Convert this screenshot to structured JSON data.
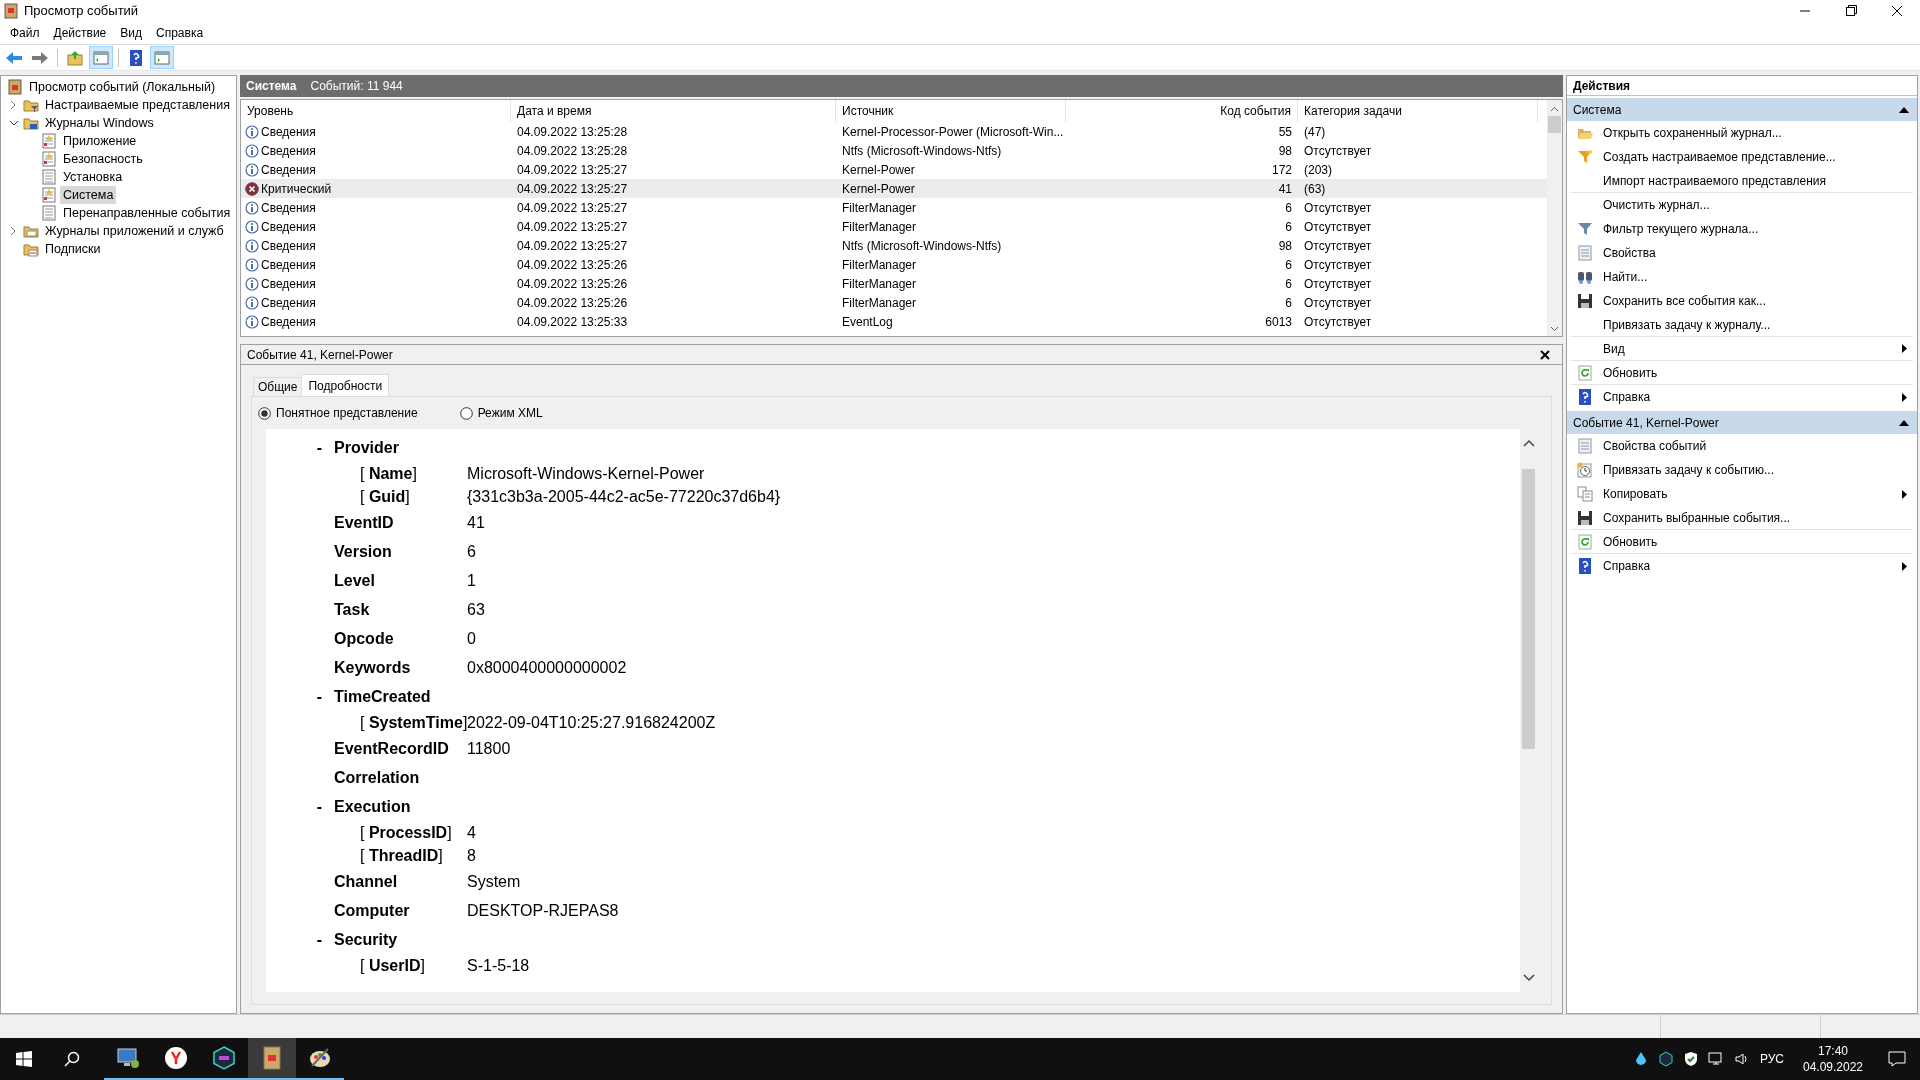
{
  "window": {
    "title": "Просмотр событий"
  },
  "menu": [
    "Файл",
    "Действие",
    "Вид",
    "Справка"
  ],
  "toolbar": [
    {
      "kind": "back",
      "pressed": false
    },
    {
      "kind": "forward",
      "pressed": false
    },
    {
      "kind": "up",
      "pressed": false
    },
    {
      "kind": "panel-left",
      "pressed": true
    },
    {
      "kind": "help",
      "pressed": false
    },
    {
      "kind": "panel-right",
      "pressed": true
    }
  ],
  "tree": [
    {
      "label": "Просмотр событий (Локальный)",
      "kind": "root",
      "selected": false,
      "children": [
        {
          "label": "Настраиваемые представления",
          "kind": "folder-filter",
          "selected": false,
          "expanded": false
        },
        {
          "label": "Журналы Windows",
          "kind": "folder-windows",
          "selected": false,
          "expanded": true,
          "children": [
            {
              "label": "Приложение",
              "kind": "log-warn",
              "selected": false
            },
            {
              "label": "Безопасность",
              "kind": "log-warn",
              "selected": false
            },
            {
              "label": "Установка",
              "kind": "log",
              "selected": false
            },
            {
              "label": "Система",
              "kind": "log-warn",
              "selected": true
            },
            {
              "label": "Перенаправленные события",
              "kind": "log",
              "selected": false
            }
          ]
        },
        {
          "label": "Журналы приложений и служб",
          "kind": "folder",
          "selected": false,
          "expanded": false
        },
        {
          "label": "Подписки",
          "kind": "subscriptions",
          "selected": false
        }
      ]
    }
  ],
  "log_header": {
    "name": "Система",
    "count": "Событий: 11 944"
  },
  "table": {
    "columns": [
      "Уровень",
      "Дата и время",
      "Источник",
      "Код события",
      "Категория задачи"
    ],
    "rows": [
      {
        "kind": "info",
        "level": "Сведения",
        "date": "04.09.2022 13:25:28",
        "source": "Kernel-Processor-Power (Microsoft-Win...",
        "code": "55",
        "category": "(47)",
        "selected": false
      },
      {
        "kind": "info",
        "level": "Сведения",
        "date": "04.09.2022 13:25:28",
        "source": "Ntfs (Microsoft-Windows-Ntfs)",
        "code": "98",
        "category": "Отсутствует",
        "selected": false
      },
      {
        "kind": "info",
        "level": "Сведения",
        "date": "04.09.2022 13:25:27",
        "source": "Kernel-Power",
        "code": "172",
        "category": "(203)",
        "selected": false
      },
      {
        "kind": "critical",
        "level": "Критический",
        "date": "04.09.2022 13:25:27",
        "source": "Kernel-Power",
        "code": "41",
        "category": "(63)",
        "selected": true
      },
      {
        "kind": "info",
        "level": "Сведения",
        "date": "04.09.2022 13:25:27",
        "source": "FilterManager",
        "code": "6",
        "category": "Отсутствует",
        "selected": false
      },
      {
        "kind": "info",
        "level": "Сведения",
        "date": "04.09.2022 13:25:27",
        "source": "FilterManager",
        "code": "6",
        "category": "Отсутствует",
        "selected": false
      },
      {
        "kind": "info",
        "level": "Сведения",
        "date": "04.09.2022 13:25:27",
        "source": "Ntfs (Microsoft-Windows-Ntfs)",
        "code": "98",
        "category": "Отсутствует",
        "selected": false
      },
      {
        "kind": "info",
        "level": "Сведения",
        "date": "04.09.2022 13:25:26",
        "source": "FilterManager",
        "code": "6",
        "category": "Отсутствует",
        "selected": false
      },
      {
        "kind": "info",
        "level": "Сведения",
        "date": "04.09.2022 13:25:26",
        "source": "FilterManager",
        "code": "6",
        "category": "Отсутствует",
        "selected": false
      },
      {
        "kind": "info",
        "level": "Сведения",
        "date": "04.09.2022 13:25:26",
        "source": "FilterManager",
        "code": "6",
        "category": "Отсутствует",
        "selected": false
      },
      {
        "kind": "info",
        "level": "Сведения",
        "date": "04.09.2022 13:25:33",
        "source": "EventLog",
        "code": "6013",
        "category": "Отсутствует",
        "selected": false
      }
    ]
  },
  "event_panel": {
    "title": "Событие 41, Kernel-Power",
    "tabs": [
      {
        "label": "Общие",
        "selected": false
      },
      {
        "label": "Подробности",
        "selected": true
      }
    ],
    "views": [
      {
        "label": "Понятное представление",
        "selected": true
      },
      {
        "label": "Режим XML",
        "selected": false
      }
    ],
    "details": [
      {
        "kind": "section",
        "toggle": "-",
        "label": "Provider",
        "children": [
          {
            "name": "[ **Name**]",
            "value": "Microsoft-Windows-Kernel-Power"
          },
          {
            "name": "[ **Guid**]",
            "value": "{331c3b3a-2005-44c2-ac5e-77220c37d6b4}"
          }
        ]
      },
      {
        "kind": "field",
        "label": "EventID",
        "value": "41"
      },
      {
        "kind": "field",
        "label": "Version",
        "value": "6"
      },
      {
        "kind": "field",
        "label": "Level",
        "value": "1"
      },
      {
        "kind": "field",
        "label": "Task",
        "value": "63"
      },
      {
        "kind": "field",
        "label": "Opcode",
        "value": "0"
      },
      {
        "kind": "field",
        "label": "Keywords",
        "value": "0x8000400000000002"
      },
      {
        "kind": "section",
        "toggle": "-",
        "label": "TimeCreated",
        "children": [
          {
            "name": "[ **SystemTime**]",
            "value": "2022-09-04T10:25:27.916824200Z"
          }
        ]
      },
      {
        "kind": "field",
        "label": "EventRecordID",
        "value": "11800"
      },
      {
        "kind": "field",
        "label": "Correlation"
      },
      {
        "kind": "section",
        "toggle": "-",
        "label": "Execution",
        "children": [
          {
            "name": "[ **ProcessID**]",
            "value": "4"
          },
          {
            "name": "[ **ThreadID**]",
            "value": "8"
          }
        ]
      },
      {
        "kind": "field",
        "label": "Channel",
        "value": "System"
      },
      {
        "kind": "field",
        "label": "Computer",
        "value": "DESKTOP-RJEPAS8"
      },
      {
        "kind": "section",
        "toggle": "-",
        "label": "Security",
        "children": [
          {
            "name": "[ **UserID**]",
            "value": "S-1-5-18"
          }
        ]
      }
    ]
  },
  "actions": {
    "title": "Действия",
    "sections": [
      {
        "title": "Система",
        "expanded": true,
        "items": [
          {
            "label": "Открыть сохраненный журнал...",
            "kind": "open",
            "submenu": false,
            "divider_after": false
          },
          {
            "label": "Создать настраиваемое представление...",
            "kind": "filter-star",
            "submenu": false,
            "divider_after": false
          },
          {
            "label": "Импорт настраиваемого представления",
            "kind": "none",
            "submenu": false,
            "divider_after": true
          },
          {
            "label": "Очистить журнал...",
            "kind": "none",
            "submenu": false,
            "divider_after": false
          },
          {
            "label": "Фильтр текущего журнала...",
            "kind": "filter",
            "submenu": false,
            "divider_after": false
          },
          {
            "label": "Свойства",
            "kind": "properties",
            "submenu": false,
            "divider_after": false
          },
          {
            "label": "Найти...",
            "kind": "find",
            "submenu": false,
            "divider_after": false
          },
          {
            "label": "Сохранить все события как...",
            "kind": "save",
            "submenu": false,
            "divider_after": false
          },
          {
            "label": "Привязать задачу к журналу...",
            "kind": "none",
            "submenu": false,
            "divider_after": true
          },
          {
            "label": "Вид",
            "kind": "none",
            "submenu": true,
            "divider_after": true
          },
          {
            "label": "Обновить",
            "kind": "refresh",
            "submenu": false,
            "divider_after": true
          },
          {
            "label": "Справка",
            "kind": "help",
            "submenu": true,
            "divider_after": false
          }
        ]
      },
      {
        "title": "Событие 41, Kernel-Power",
        "expanded": true,
        "items": [
          {
            "label": "Свойства событий",
            "kind": "properties",
            "submenu": false,
            "divider_after": false
          },
          {
            "label": "Привязать задачу к событию...",
            "kind": "task",
            "submenu": false,
            "divider_after": false
          },
          {
            "label": "Копировать",
            "kind": "copy",
            "submenu": true,
            "divider_after": false
          },
          {
            "label": "Сохранить выбранные события...",
            "kind": "save",
            "submenu": false,
            "divider_after": true
          },
          {
            "label": "Обновить",
            "kind": "refresh",
            "submenu": false,
            "divider_after": true
          },
          {
            "label": "Справка",
            "kind": "help",
            "submenu": true,
            "divider_after": false
          }
        ]
      }
    ]
  },
  "taskbar": {
    "language": "РУС",
    "time": "17:40",
    "date": "04.09.2022"
  }
}
